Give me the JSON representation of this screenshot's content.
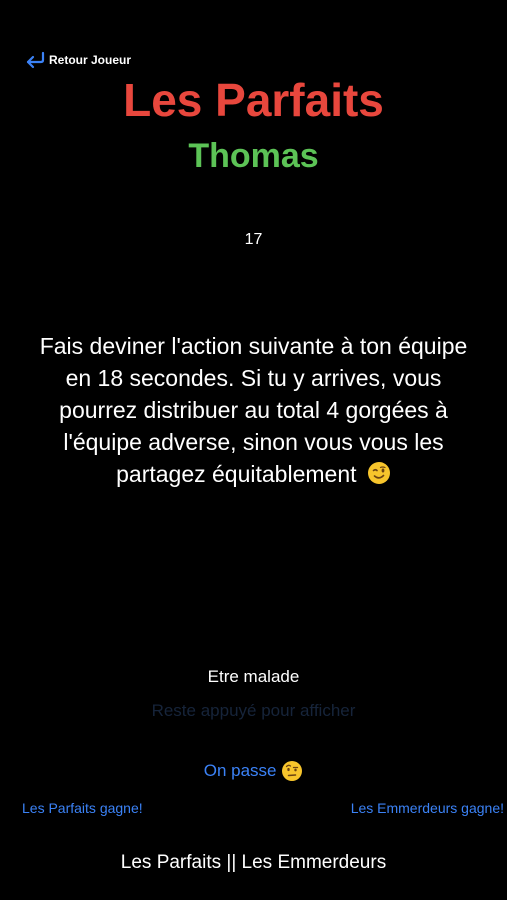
{
  "nav": {
    "back_label": "Retour Joueur",
    "back_icon": "return-arrow-icon"
  },
  "header": {
    "team_name": "Les Parfaits",
    "player_name": "Thomas"
  },
  "timer": {
    "value": "17"
  },
  "challenge": {
    "text": "Fais deviner l'action suivante à ton équipe en 18 secondes. Si tu y arrives, vous pourrez distribuer au total 4 gorgées à l'équipe adverse, sinon vous vous les partagez équitablement",
    "emoji": "winking-face-icon"
  },
  "action": {
    "word": "Etre malade",
    "reveal_hint": "Reste appuyé pour afficher"
  },
  "controls": {
    "pass_label": "On passe",
    "pass_emoji": "face-with-raised-eyebrow-icon",
    "team1_wins_label": "Les Parfaits gagne!",
    "team2_wins_label": "Les Emmerdeurs gagne!"
  },
  "footer": {
    "scoreboard": "Les Parfaits || Les Emmerdeurs"
  },
  "colors": {
    "background": "#000000",
    "team_title": "#e8473d",
    "player_name": "#5cc356",
    "link_blue": "#3b82f6",
    "hint_text": "#16243a"
  }
}
